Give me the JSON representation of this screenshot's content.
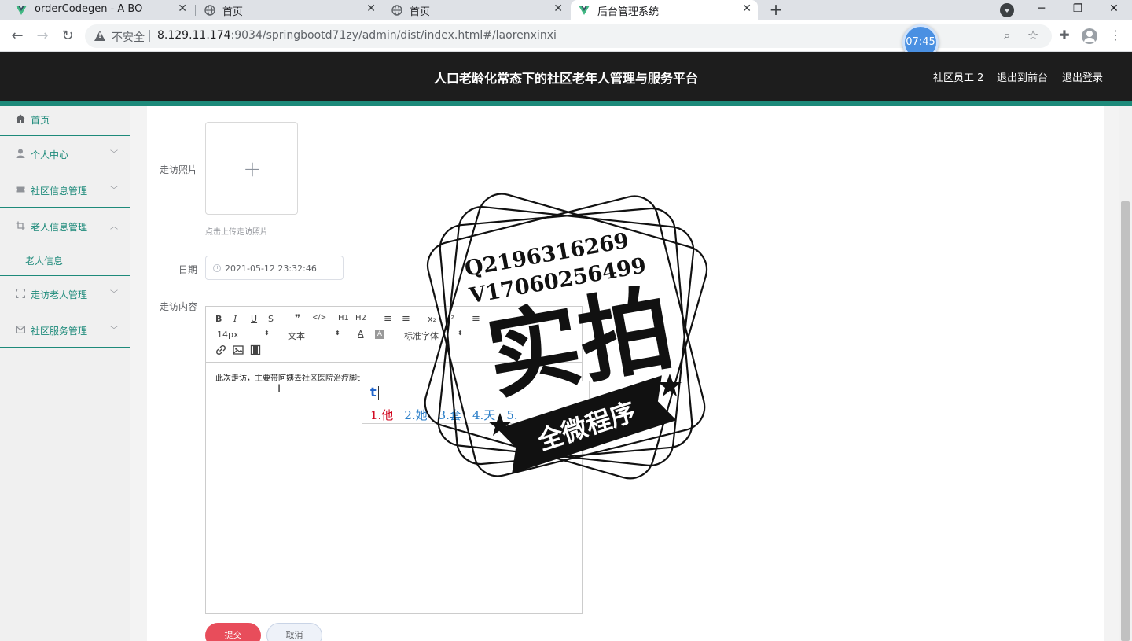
{
  "browser": {
    "tabs": [
      {
        "label": "orderCodegen - A BO",
        "icon": "vue-icon"
      },
      {
        "label": "首页",
        "icon": "globe-icon"
      },
      {
        "label": "首页",
        "icon": "globe-icon"
      },
      {
        "label": "后台管理系统",
        "icon": "vue-icon",
        "active": true
      }
    ],
    "tab_close": "✕",
    "new_tab": "+",
    "window": {
      "minimize": "─",
      "restore": "❐",
      "close": "✕"
    },
    "security_label": "不安全",
    "url_host": "8.129.11.174",
    "url_rest": ":9034/springbootd71zy/admin/dist/index.html#/laorenxinxi",
    "clock": "07:45"
  },
  "header": {
    "title": "人口老龄化常态下的社区老年人管理与服务平台",
    "user": "社区员工 2",
    "to_front": "退出到前台",
    "logout": "退出登录"
  },
  "sidebar": {
    "items": [
      {
        "label": "首页",
        "icon": "home-icon"
      },
      {
        "label": "个人中心",
        "icon": "user-icon",
        "chevron": "﹀"
      },
      {
        "label": "社区信息管理",
        "icon": "ticket-icon",
        "chevron": "﹀"
      },
      {
        "label": "老人信息管理",
        "icon": "crop-icon",
        "chevron": "︿"
      },
      {
        "label": "走访老人管理",
        "icon": "fullscreen-icon",
        "chevron": "﹀"
      },
      {
        "label": "社区服务管理",
        "icon": "message-icon",
        "chevron": "﹀"
      }
    ],
    "subitem": "老人信息"
  },
  "form": {
    "photo_label": "走访照片",
    "upload_plus": "+",
    "upload_tip": "点击上传走访照片",
    "date_label": "日期",
    "date_value": "2021-05-12 23:32:46",
    "content_label": "走访内容",
    "submit": "提交",
    "cancel": "取消"
  },
  "editor": {
    "toolbar_row1": [
      "B",
      "I",
      "U",
      "S",
      "❞",
      "</>",
      "H1",
      "H2",
      "≡",
      "≡",
      "x₂",
      "x²",
      "≡"
    ],
    "font_size": "14px",
    "text_type": "文本",
    "font_family": "标准字体",
    "text": "此次走访，主要带阿姨去社区医院治疗脚t"
  },
  "ime": {
    "input": "t",
    "candidates": [
      "1.他",
      "2.她",
      "3.套",
      "4.天",
      "5."
    ]
  },
  "watermark": {
    "contact1": "Q2196316269",
    "contact2": "V17060256499",
    "big": "实拍",
    "banner": "全微程序"
  }
}
